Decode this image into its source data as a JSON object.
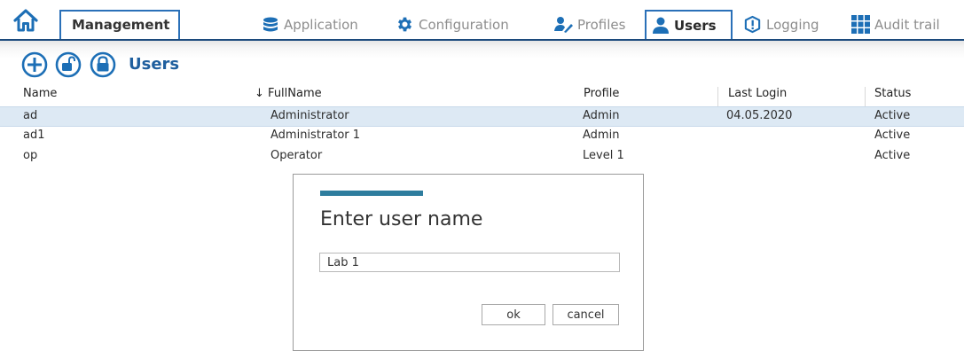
{
  "tabs": {
    "home_icon": "home-icon",
    "management": "Management",
    "items": [
      {
        "label": "Application",
        "icon": "database-icon",
        "active": false
      },
      {
        "label": "Configuration",
        "icon": "gear-icon",
        "active": false
      },
      {
        "label": "Profiles",
        "icon": "profiles-icon",
        "active": false
      },
      {
        "label": "Users",
        "icon": "user-icon",
        "active": true
      },
      {
        "label": "Logging",
        "icon": "logging-icon",
        "active": false
      },
      {
        "label": "Audit trail",
        "icon": "grid-icon",
        "active": false
      }
    ]
  },
  "toolbar": {
    "title": "Users",
    "buttons": [
      "add-circle-icon",
      "unlock-icon",
      "lock-icon"
    ]
  },
  "table": {
    "columns": [
      "Name",
      "FullName",
      "Profile",
      "Last Login",
      "Status"
    ],
    "sort_indicator": "↓",
    "rows": [
      {
        "name": "ad",
        "fullname": "Administrator",
        "profile": "Admin",
        "last_login": "04.05.2020",
        "status": "Active",
        "selected": true
      },
      {
        "name": "ad1",
        "fullname": "Administrator 1",
        "profile": "Admin",
        "last_login": "",
        "status": "Active",
        "selected": false
      },
      {
        "name": "op",
        "fullname": "Operator",
        "profile": "Level 1",
        "last_login": "",
        "status": "Active",
        "selected": false
      }
    ]
  },
  "dialog": {
    "title": "Enter user name",
    "input_value": "Lab 1",
    "ok_label": "ok",
    "cancel_label": "cancel"
  },
  "colors": {
    "accent": "#2a70b8",
    "title_blue": "#1f5f9e",
    "dialog_accent": "#2e7d9e",
    "selected_row": "#dde9f4"
  }
}
